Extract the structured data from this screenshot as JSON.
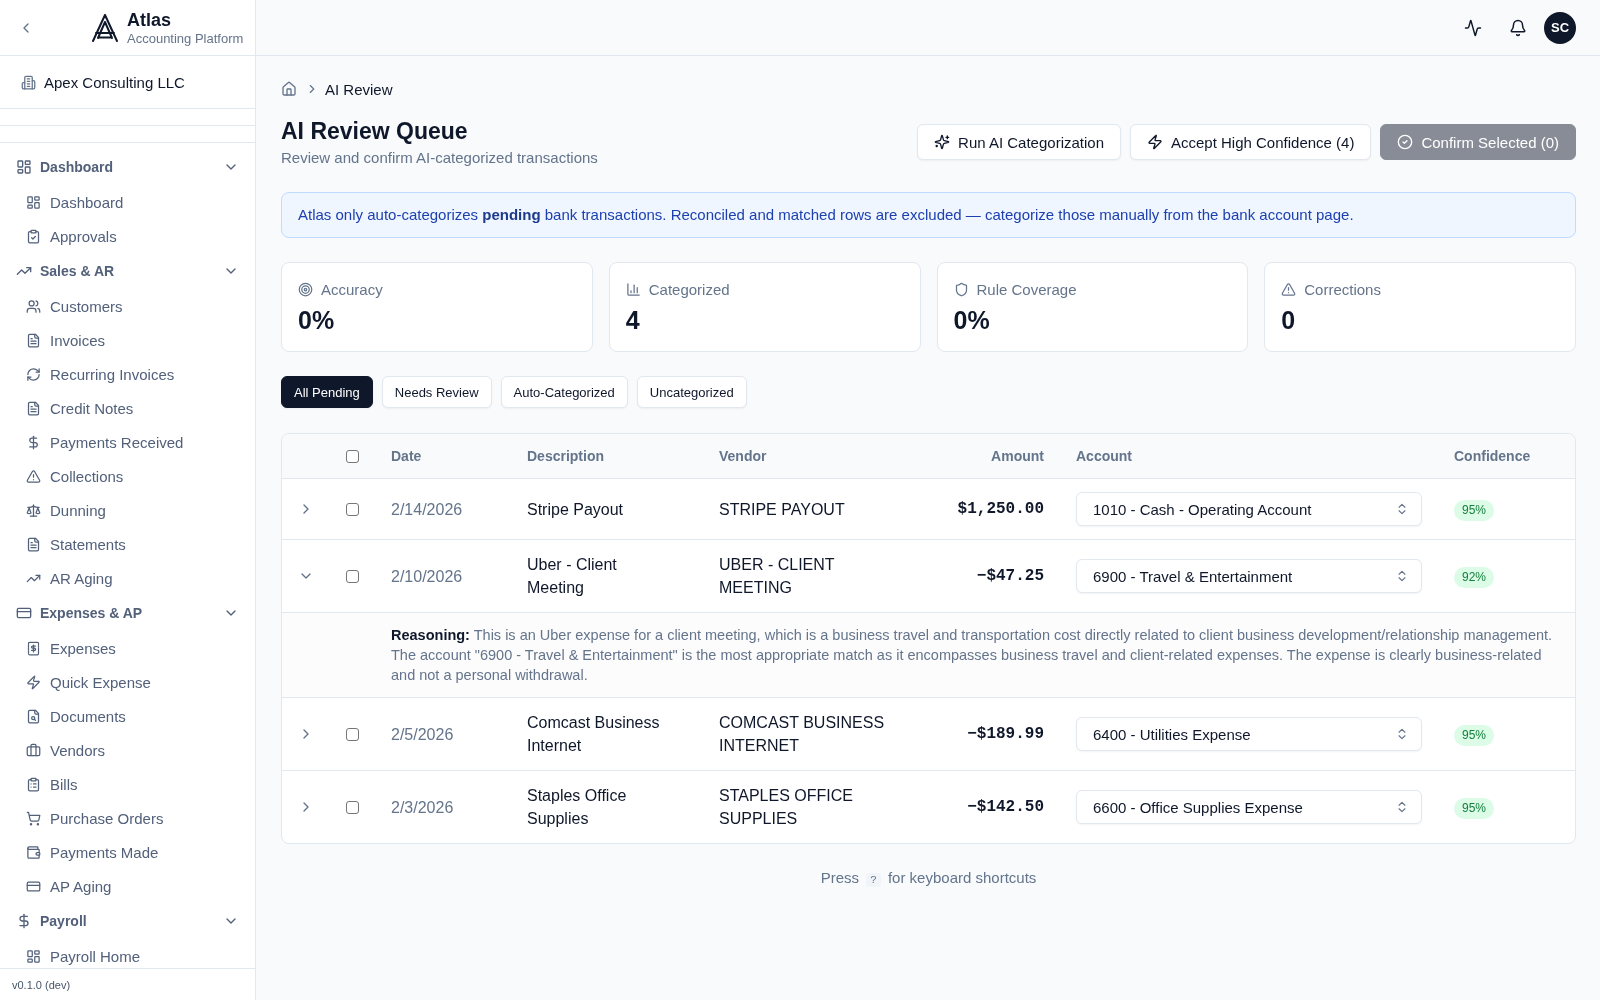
{
  "sidebar": {
    "brand": {
      "name": "Atlas",
      "tagline": "Accounting Platform"
    },
    "company": "Apex Consulting LLC",
    "groups": [
      {
        "label": "Dashboard",
        "expanded": true,
        "items": [
          {
            "label": "Dashboard",
            "selected": false
          },
          {
            "label": "Approvals",
            "selected": false
          }
        ]
      },
      {
        "label": "Sales & AR",
        "expanded": true,
        "items": [
          {
            "label": "Customers",
            "selected": false
          },
          {
            "label": "Invoices",
            "selected": false
          },
          {
            "label": "Recurring Invoices",
            "selected": false
          },
          {
            "label": "Credit Notes",
            "selected": false
          },
          {
            "label": "Payments Received",
            "selected": false
          },
          {
            "label": "Collections",
            "selected": false
          },
          {
            "label": "Dunning",
            "selected": false
          },
          {
            "label": "Statements",
            "selected": false
          },
          {
            "label": "AR Aging",
            "selected": false
          }
        ]
      },
      {
        "label": "Expenses & AP",
        "expanded": true,
        "items": [
          {
            "label": "Expenses",
            "selected": false
          },
          {
            "label": "Quick Expense",
            "selected": false
          },
          {
            "label": "Documents",
            "selected": false
          },
          {
            "label": "Vendors",
            "selected": false
          },
          {
            "label": "Bills",
            "selected": false
          },
          {
            "label": "Purchase Orders",
            "selected": false
          },
          {
            "label": "Payments Made",
            "selected": false
          },
          {
            "label": "AP Aging",
            "selected": false
          }
        ]
      },
      {
        "label": "Payroll",
        "expanded": true,
        "items": [
          {
            "label": "Payroll Home",
            "selected": false
          }
        ]
      }
    ],
    "version": "v0.1.0 (dev)"
  },
  "topbar": {
    "avatar": "SC"
  },
  "breadcrumb": {
    "current": "AI Review"
  },
  "header": {
    "title": "AI Review Queue",
    "subtitle": "Review and confirm AI-categorized transactions"
  },
  "actions": [
    {
      "label": "Run AI Categorization",
      "disabled": false
    },
    {
      "label": "Accept High Confidence (4)",
      "disabled": false
    },
    {
      "label": "Confirm Selected (0)",
      "disabled": true
    }
  ],
  "notice": "Atlas only auto-categorizes **pending** bank transactions. Reconciled and matched rows are excluded — categorize those manually from the bank account page.",
  "stats": [
    {
      "label": "Accuracy",
      "value": "0%"
    },
    {
      "label": "Categorized",
      "value": "4"
    },
    {
      "label": "Rule Coverage",
      "value": "0%"
    },
    {
      "label": "Corrections",
      "value": "0"
    }
  ],
  "filters": [
    {
      "label": "All Pending",
      "selected": true
    },
    {
      "label": "Needs Review",
      "selected": false
    },
    {
      "label": "Auto-Categorized",
      "selected": false
    },
    {
      "label": "Uncategorized",
      "selected": false
    }
  ],
  "table": {
    "select_all": {
      "checked": false
    },
    "columns": [
      "Date",
      "Description",
      "Vendor",
      "Amount",
      "Account",
      "Confidence"
    ],
    "rows": [
      {
        "expanded": false,
        "checked": false,
        "date": "2/14/2026",
        "description": "Stripe Payout",
        "vendor": "STRIPE PAYOUT",
        "amount": "$1,250.00",
        "account": "1010 - Cash - Operating Account",
        "confidence": "95%"
      },
      {
        "expanded": true,
        "checked": false,
        "date": "2/10/2026",
        "description": "Uber - Client Meeting",
        "vendor": "UBER - CLIENT MEETING",
        "amount": "−$47.25",
        "account": "6900 - Travel & Entertainment",
        "confidence": "92%",
        "reasoning": "**Reasoning:** This is an Uber expense for a client meeting, which is a business travel and transportation cost directly related to client business development/relationship management. The account \"6900 - Travel & Entertainment\" is the most appropriate match as it encompasses business travel and client-related expenses. The expense is clearly business-related and not a personal withdrawal."
      },
      {
        "expanded": false,
        "checked": false,
        "date": "2/5/2026",
        "description": "Comcast Business Internet",
        "vendor": "COMCAST BUSINESS INTERNET",
        "amount": "−$189.99",
        "account": "6400 - Utilities Expense",
        "confidence": "95%"
      },
      {
        "expanded": false,
        "checked": false,
        "date": "2/3/2026",
        "description": "Staples Office Supplies",
        "vendor": "STAPLES OFFICE SUPPLIES",
        "amount": "−$142.50",
        "account": "6600 - Office Supplies Expense",
        "confidence": "95%"
      }
    ]
  },
  "shortcut_hint": {
    "before": "Press",
    "key": "?",
    "after": "for keyboard shortcuts"
  }
}
